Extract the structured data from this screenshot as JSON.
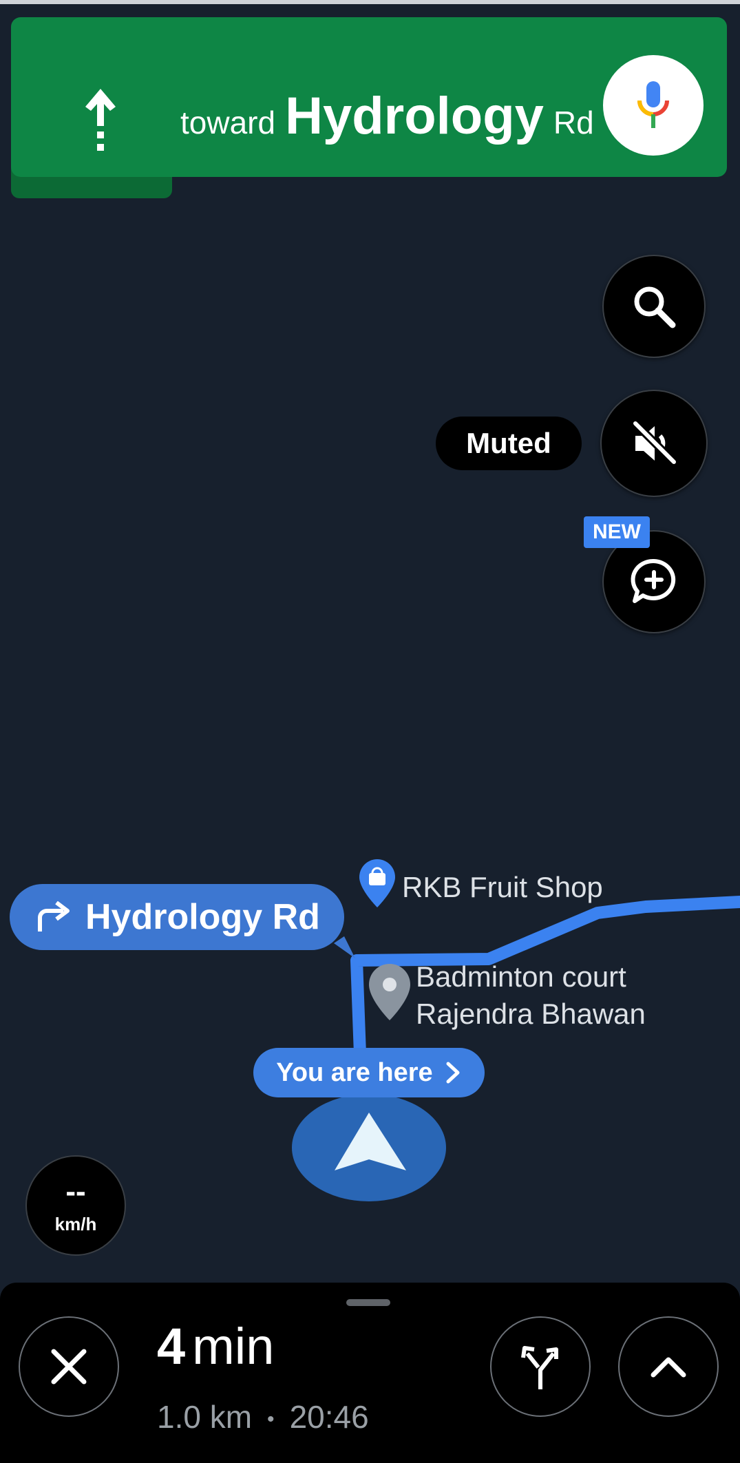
{
  "nav_banner": {
    "toward": "toward",
    "street_name": "Hydrology",
    "street_suffix": "Rd",
    "background_color": "#0e8645",
    "arrow_icon": "straight-arrow-icon",
    "mic_icon": "mic-icon"
  },
  "map_controls": {
    "search_icon": "search-icon",
    "sound_icon": "volume-off-icon",
    "muted_label": "Muted",
    "report_icon": "add-comment-icon",
    "new_badge": "NEW"
  },
  "map": {
    "next_turn": {
      "icon": "turn-right-icon",
      "label": "Hydrology Rd"
    },
    "pois": [
      {
        "name": "RKB Fruit Shop",
        "icon": "shopping-bag-pin-icon"
      },
      {
        "name_line1": "Badminton court",
        "name_line2": "Rajendra Bhawan",
        "icon": "location-pin-icon"
      }
    ],
    "you_are_here": "You are here",
    "route_color": "#3b82f0"
  },
  "speedometer": {
    "value": "--",
    "unit": "km/h"
  },
  "trip": {
    "time_value": "4",
    "time_unit": "min",
    "distance": "1.0 km",
    "separator": "•",
    "arrival": "20:46",
    "close_icon": "close-icon",
    "alternates_icon": "route-alternates-icon",
    "expand_icon": "chevron-up-icon"
  }
}
